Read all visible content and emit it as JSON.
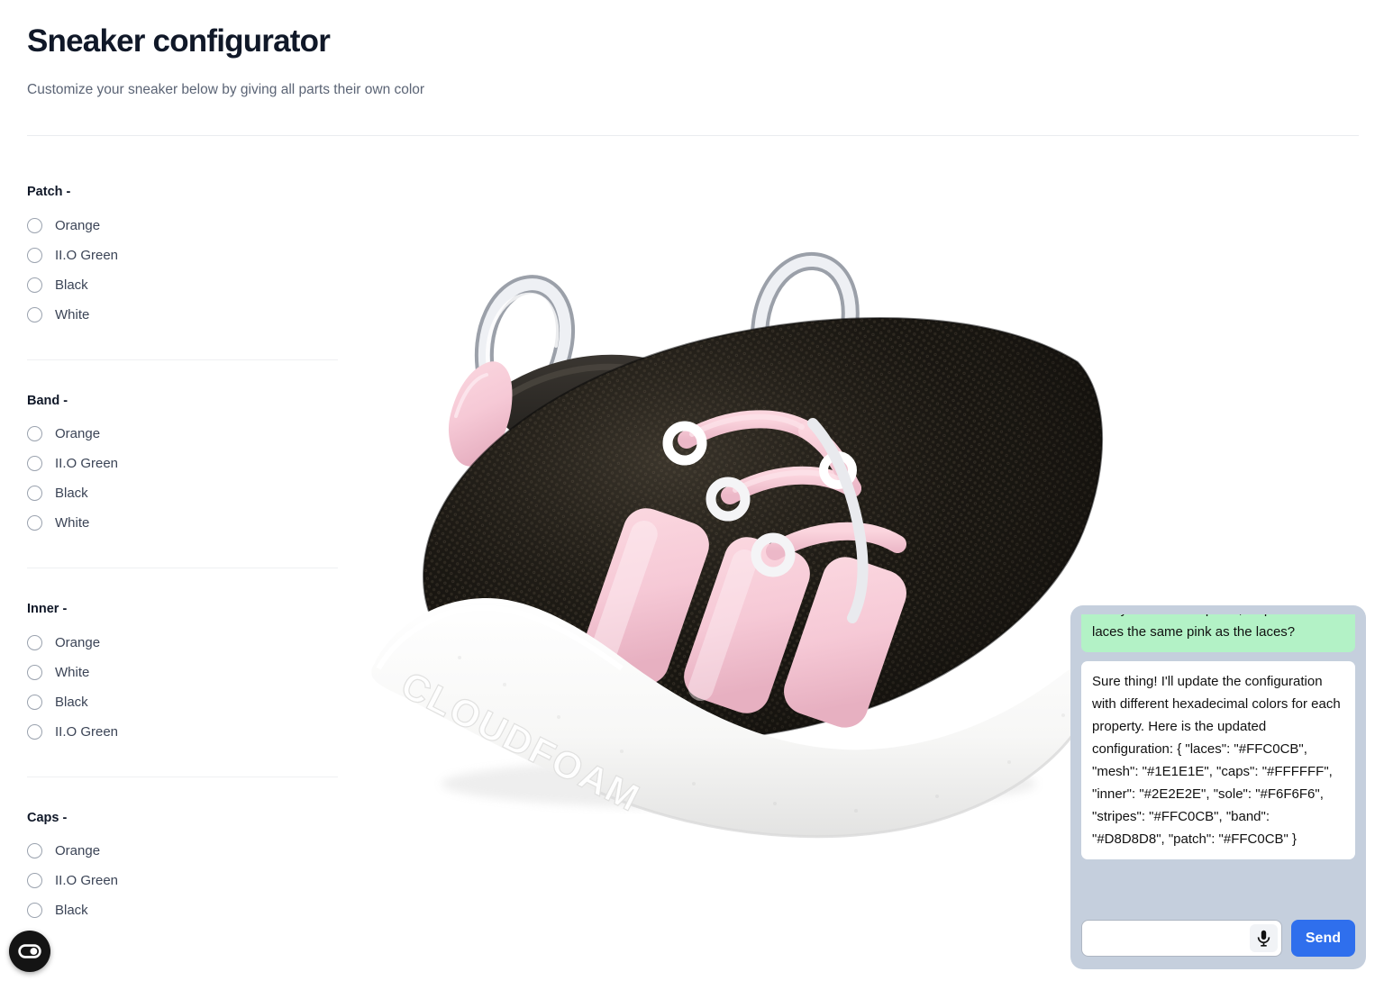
{
  "header": {
    "title": "Sneaker configurator",
    "subtitle": "Customize your sneaker below by giving all parts their own color"
  },
  "config_groups": [
    {
      "title": "Patch -",
      "name": "patch",
      "options": [
        {
          "label": "Orange",
          "selected": false
        },
        {
          "label": "II.O Green",
          "selected": false
        },
        {
          "label": "Black",
          "selected": false
        },
        {
          "label": "White",
          "selected": false
        }
      ]
    },
    {
      "title": "Band -",
      "name": "band",
      "options": [
        {
          "label": "Orange",
          "selected": false
        },
        {
          "label": "II.O Green",
          "selected": false
        },
        {
          "label": "Black",
          "selected": false
        },
        {
          "label": "White",
          "selected": false
        }
      ]
    },
    {
      "title": "Inner -",
      "name": "inner",
      "options": [
        {
          "label": "Orange",
          "selected": false
        },
        {
          "label": "White",
          "selected": false
        },
        {
          "label": "Black",
          "selected": false
        },
        {
          "label": "II.O Green",
          "selected": false
        }
      ]
    },
    {
      "title": "Caps -",
      "name": "caps",
      "options": [
        {
          "label": "Orange",
          "selected": false
        },
        {
          "label": "II.O Green",
          "selected": false
        },
        {
          "label": "Black",
          "selected": false
        }
      ]
    }
  ],
  "sneaker": {
    "sole_text": "CLOUDFOAM",
    "colors": {
      "laces": "#FFC0CB",
      "mesh": "#1E1E1E",
      "caps": "#FFFFFF",
      "inner": "#2E2E2E",
      "sole": "#F6F6F6",
      "stripes": "#FFC0CB",
      "band": "#D8D8D8",
      "patch": "#FFC0CB"
    }
  },
  "accessibility_widget": {
    "label": "Accessibility options"
  },
  "chat": {
    "messages": [
      {
        "role": "user",
        "text": "Can you make the patch, stripes and laces the same pink as the laces?"
      },
      {
        "role": "assistant",
        "text": "Sure thing! I'll update the configuration with different hexadecimal colors for each property. Here is the updated configuration: { \"laces\": \"#FFC0CB\", \"mesh\": \"#1E1E1E\", \"caps\": \"#FFFFFF\", \"inner\": \"#2E2E2E\", \"sole\": \"#F6F6F6\", \"stripes\": \"#FFC0CB\", \"band\": \"#D8D8D8\", \"patch\": \"#FFC0CB\" }"
      }
    ],
    "input_value": "",
    "input_placeholder": "",
    "mic_label": "microphone",
    "send_label": "Send",
    "accent_color": "#2F6FED",
    "user_bubble_color": "#B3F2C6",
    "panel_color": "#C5CFDD"
  }
}
